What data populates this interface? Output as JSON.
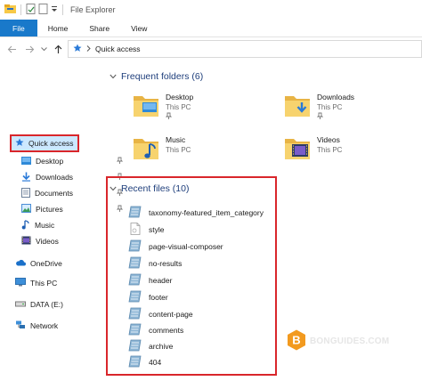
{
  "window": {
    "title": "File Explorer"
  },
  "ribbon": {
    "tabs": [
      "File",
      "Home",
      "Share",
      "View"
    ]
  },
  "address": {
    "location": "Quick access"
  },
  "sidebar": {
    "quick_access": "Quick access",
    "items": [
      {
        "label": "Desktop",
        "icon": "desktop-icon",
        "pinned": true
      },
      {
        "label": "Downloads",
        "icon": "download-icon",
        "pinned": true
      },
      {
        "label": "Documents",
        "icon": "documents-icon",
        "pinned": true
      },
      {
        "label": "Pictures",
        "icon": "pictures-icon",
        "pinned": true
      },
      {
        "label": "Music",
        "icon": "music-icon",
        "pinned": false
      },
      {
        "label": "Videos",
        "icon": "videos-icon",
        "pinned": false
      }
    ],
    "onedrive": "OneDrive",
    "this_pc": "This PC",
    "drive": "DATA (E:)",
    "network": "Network"
  },
  "frequent": {
    "header": "Frequent folders (6)",
    "folders": [
      {
        "name": "Desktop",
        "location": "This PC",
        "pinned": true,
        "icon": "desktop-folder-icon"
      },
      {
        "name": "Downloads",
        "location": "This PC",
        "pinned": true,
        "icon": "downloads-folder-icon"
      },
      {
        "name": "Music",
        "location": "This PC",
        "pinned": false,
        "icon": "music-folder-icon"
      },
      {
        "name": "Videos",
        "location": "This PC",
        "pinned": false,
        "icon": "videos-folder-icon"
      }
    ]
  },
  "recent": {
    "header": "Recent files (10)",
    "files": [
      "taxonomy-featured_item_category",
      "style",
      "page-visual-composer",
      "no-results",
      "header",
      "footer",
      "content-page",
      "comments",
      "archive",
      "404"
    ]
  },
  "watermark": {
    "text": "BONGUIDES.COM",
    "logo_letter": "B"
  },
  "colors": {
    "accent": "#1979ca",
    "highlight_border": "#d9262b",
    "selection": "#cce8ff",
    "section_header": "#1e3e7b"
  }
}
